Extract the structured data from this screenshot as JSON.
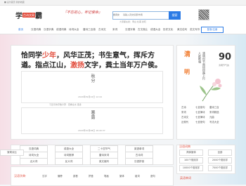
{
  "topbar": {
    "left": "■ 设为首页  我的收藏"
  },
  "header": {
    "logo_a": "学",
    "logo_b": "古诗文网",
    "logo_c": "霸",
    "slogan": "『不忘初心，牢记使命』",
    "search_select": "搜诗文",
    "search_placeholder": "请输入诗文标题/作者",
    "search_button": "搜索",
    "hot_words": "大家都在搜：李白 杜甫 春晓"
  },
  "nav": {
    "items": [
      "首页",
      "汉语词典",
      "汉语字典",
      "成语词典",
      "诗词大全",
      "唐诗三百首",
      "古诗文",
      "宋词",
      "汉语字典",
      "古文观止",
      "成语大全",
      "历史文化",
      "美文佳句",
      "范文写作"
    ],
    "button": "登录/注册"
  },
  "headline": {
    "p1": "恰同学",
    "h1": "少年",
    "p2": "，风华正茂；书生意气，挥斥方遒。指点江山，",
    "h2": "激扬",
    "p3": "文字，粪土当年万户侯。"
  },
  "card1": {
    "verse": "秋分",
    "meta1": "2024年09月22日 12:44",
    "meta2": "习近平的字数计算 · 查看全文 更多"
  },
  "card2": {
    "verse": "寒露",
    "meta": "2024年10月08日 16:40:37"
  },
  "side": {
    "jieqi_a": "清",
    "jieqi_b": "明",
    "score": "90",
    "score_sub": "清明节气的",
    "poem": "清明时节雨纷纷路上行人欲断魂",
    "links": [
      [
        "古诗",
        "七言绝句",
        "唐诗三百"
      ],
      [
        "宋词",
        "七言律诗",
        "宋词精选"
      ],
      [
        "古诗文",
        "七言律诗",
        "元曲"
      ],
      [
        "近现代",
        "七言绝句",
        "写法大全"
      ]
    ]
  },
  "grid": {
    "buttons": [
      [
        "汉语词典",
        "成语大全",
        "二十四节气",
        "英语单词"
      ],
      [
        "诗词大全",
        "诗词推荐",
        "唐诗宋词",
        "古诗词"
      ],
      [
        "近义词",
        "反义词",
        "英文缩写",
        "汉语拼音"
      ]
    ]
  },
  "sec2": {
    "title": "汉语词典",
    "buttons": [
      [
        "简体繁体",
        "全部",
        "繁简对比"
      ],
      [
        "100个常用字",
        "",
        "2000个常用字"
      ],
      [
        "10000个常用字",
        "",
        "7000个常用字"
      ]
    ]
  },
  "bottom": {
    "title": "汉语字典·",
    "items": [
      "汉字",
      "偏旁",
      "部首",
      "拼音",
      "笔画",
      "繁体",
      "组词",
      "造句"
    ]
  },
  "sec3": {
    "title": "英语单词"
  }
}
